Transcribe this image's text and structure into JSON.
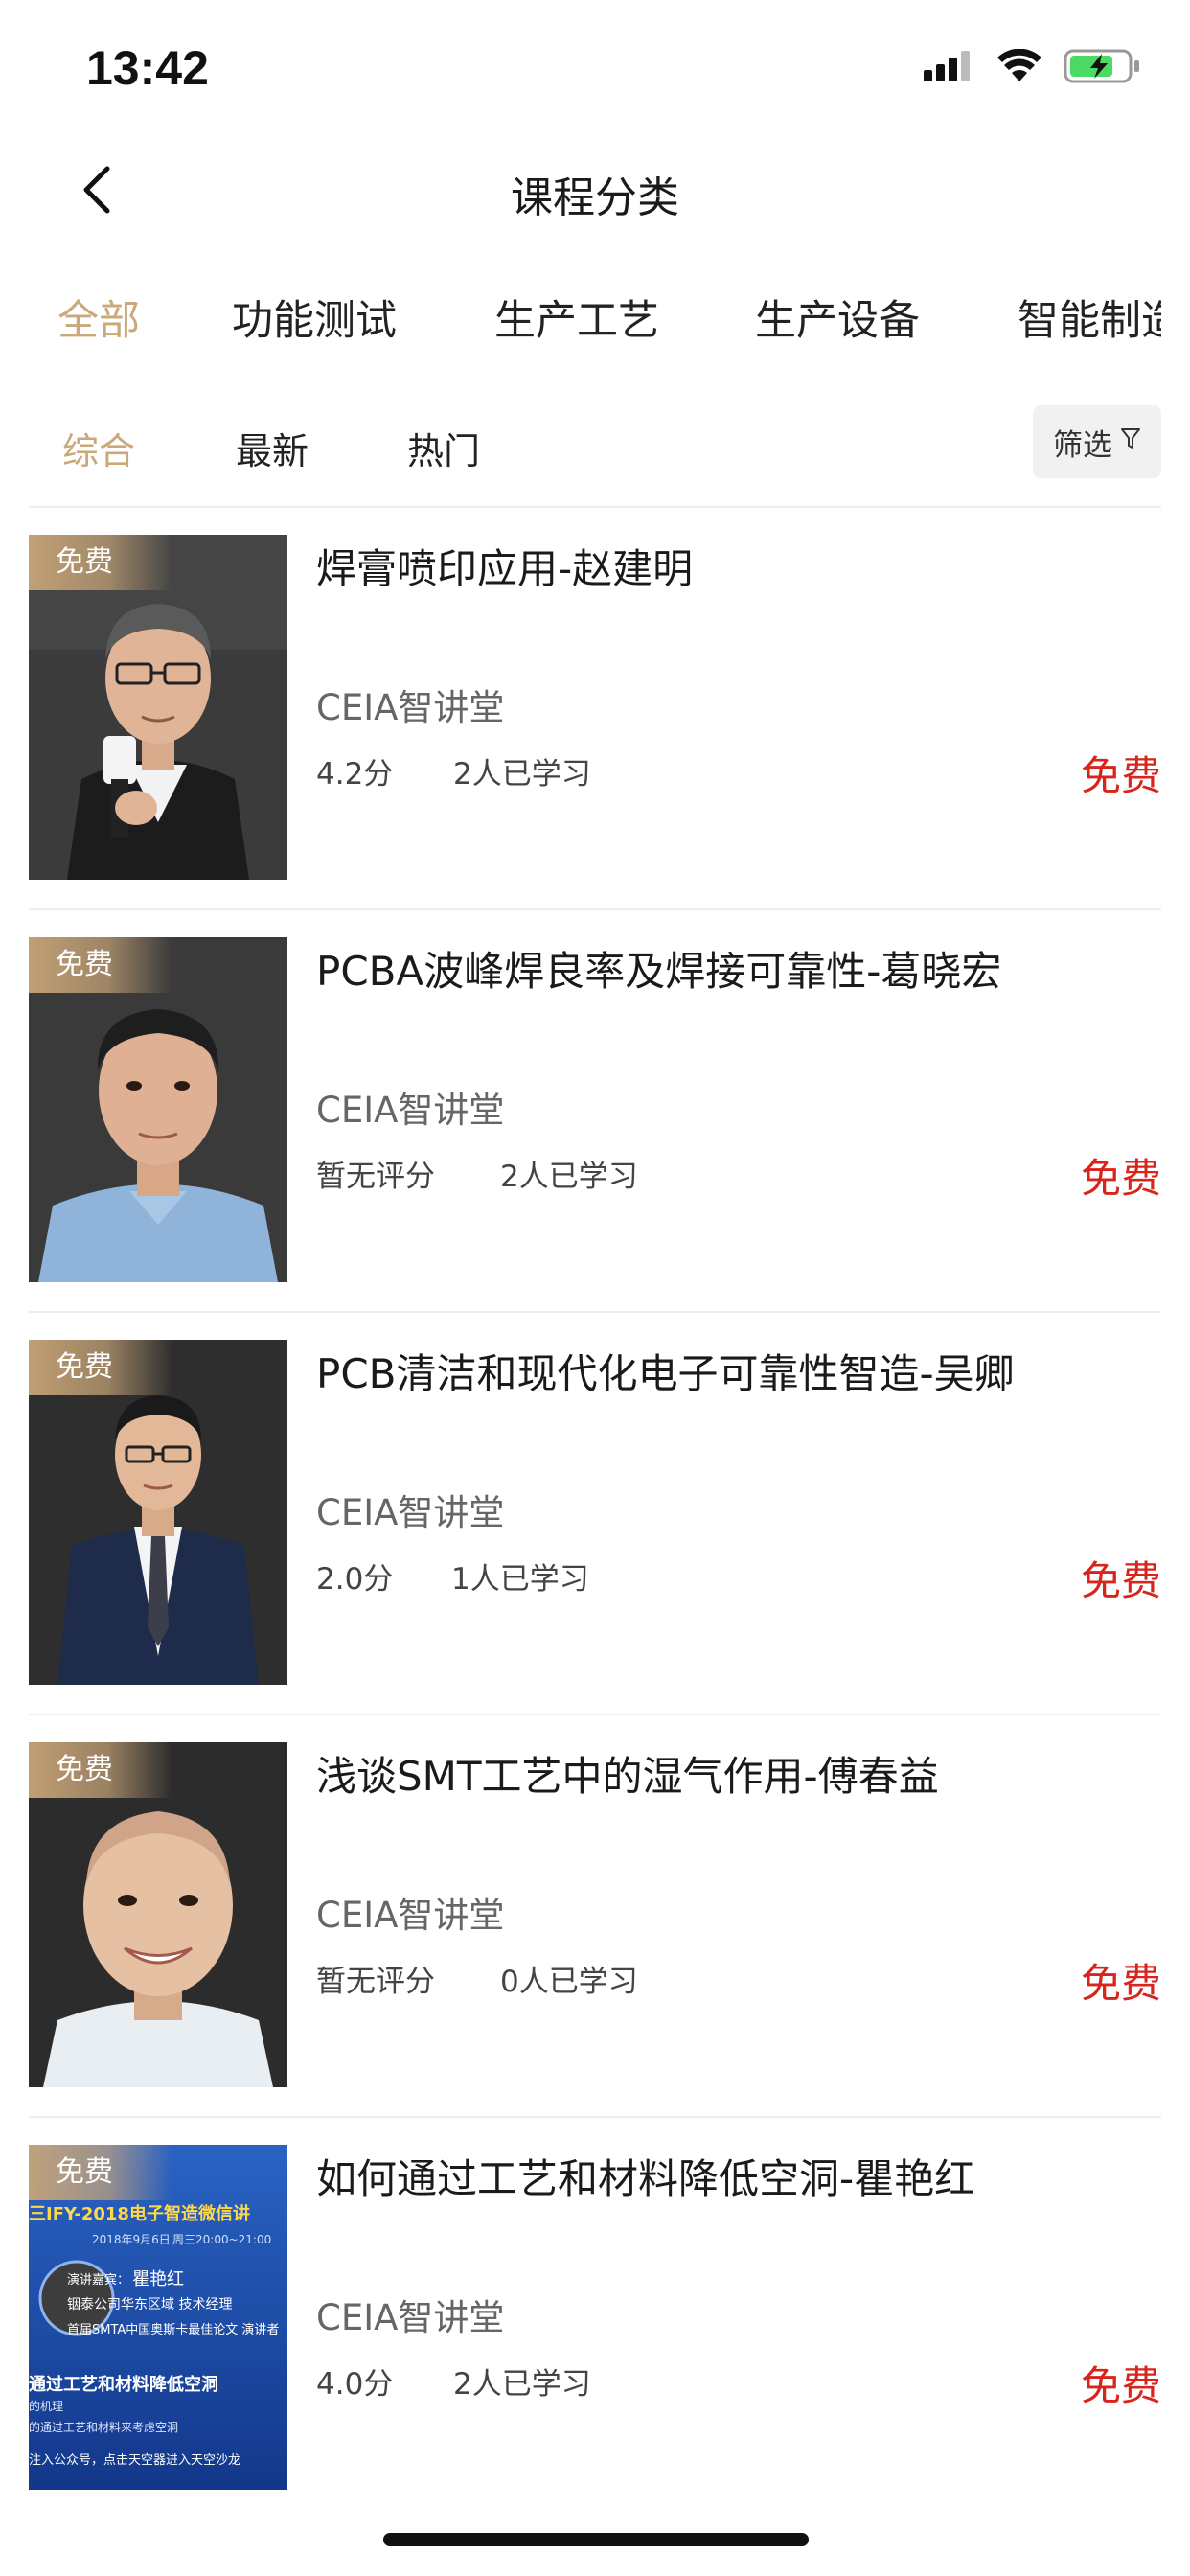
{
  "status_bar": {
    "time": "13:42",
    "icons": [
      "signal-icon",
      "wifi-icon",
      "battery-charging-icon"
    ]
  },
  "nav": {
    "title": "课程分类",
    "back_icon": "chevron-left-icon"
  },
  "category_tabs": [
    {
      "label": "全部",
      "active": true
    },
    {
      "label": "功能测试",
      "active": false
    },
    {
      "label": "生产工艺",
      "active": false
    },
    {
      "label": "生产设备",
      "active": false
    },
    {
      "label": "智能制造",
      "active": false
    }
  ],
  "sort_tabs": [
    {
      "label": "综合",
      "active": true
    },
    {
      "label": "最新",
      "active": false
    },
    {
      "label": "热门",
      "active": false
    }
  ],
  "filter": {
    "label": "筛选",
    "icon": "filter-icon"
  },
  "colors": {
    "accent": "#c9a87a",
    "price": "#d8241b",
    "free_tag_bg": "#c8a578"
  },
  "courses": [
    {
      "tag": "免费",
      "title": "焊膏喷印应用-赵建明",
      "provider": "CEIA智讲堂",
      "rating": "4.2分",
      "learners": "2人已学习",
      "price": "免费",
      "thumb": "presenter-with-microphone"
    },
    {
      "tag": "免费",
      "title": "PCBA波峰焊良率及焊接可靠性-葛晓宏",
      "provider": "CEIA智讲堂",
      "rating": "暂无评分",
      "learners": "2人已学习",
      "price": "免费",
      "thumb": "portrait-blue-shirt"
    },
    {
      "tag": "免费",
      "title": "PCB清洁和现代化电子可靠性智造-吴卿",
      "provider": "CEIA智讲堂",
      "rating": "2.0分",
      "learners": "1人已学习",
      "price": "免费",
      "thumb": "portrait-suit-glasses"
    },
    {
      "tag": "免费",
      "title": "浅谈SMT工艺中的湿气作用-傅春益",
      "provider": "CEIA智讲堂",
      "rating": "暂无评分",
      "learners": "0人已学习",
      "price": "免费",
      "thumb": "portrait-smiling"
    },
    {
      "tag": "免费",
      "title": "如何通过工艺和材料降低空洞-瞿艳红",
      "provider": "CEIA智讲堂",
      "rating": "4.0分",
      "learners": "2人已学习",
      "price": "免费",
      "thumb": "event-poster-blue",
      "poster": {
        "headline": "三IFY-2018电子智造微信讲",
        "date": "2018年9月6日",
        "time": "周三20:00~21:00",
        "speaker_label": "演讲嘉宾：",
        "speaker": "瞿艳红",
        "company": "铟泰公司华东区域 技术经理",
        "award": "首届SMTA中国奥斯卡最佳论文 演讲者",
        "topic": "通过工艺和材料降低空洞",
        "line1": "的机理",
        "line2": "的通过工艺和材料来考虑空洞",
        "line3": "注入公众号，点击天空器进入天空沙龙"
      }
    }
  ]
}
